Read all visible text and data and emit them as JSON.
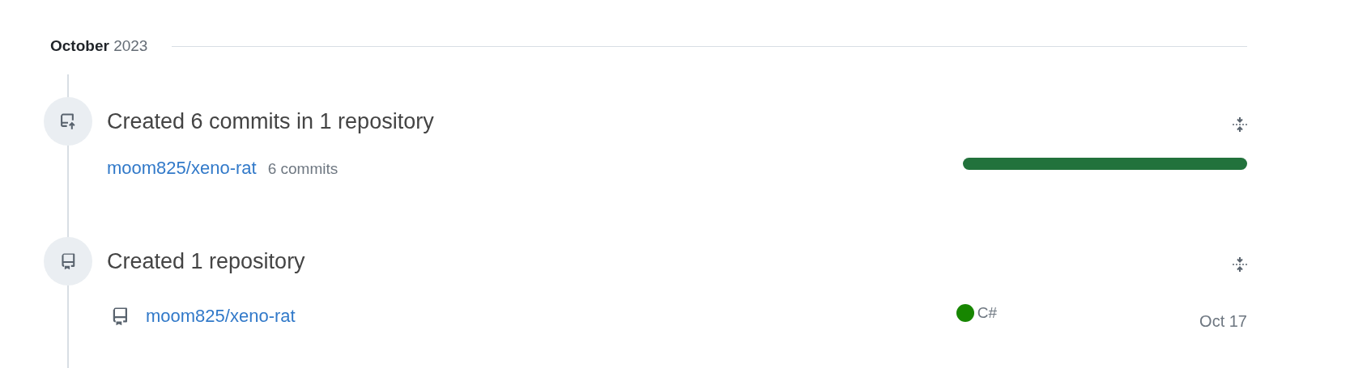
{
  "month": "**October** 2023",
  "items": [
    {
      "kind": "commits",
      "title": "Created 6 commits in 1 repository",
      "repos": [
        {
          "name": "moom825/xeno-rat",
          "count": "6 commits",
          "level": 1
        }
      ]
    },
    {
      "kind": "repository",
      "title": "Created 1 repository",
      "repos": [
        {
          "name": "moom825/xeno-rat",
          "language": "C#",
          "color": "#178600",
          "date": "Oct 17"
        }
      ]
    }
  ]
}
